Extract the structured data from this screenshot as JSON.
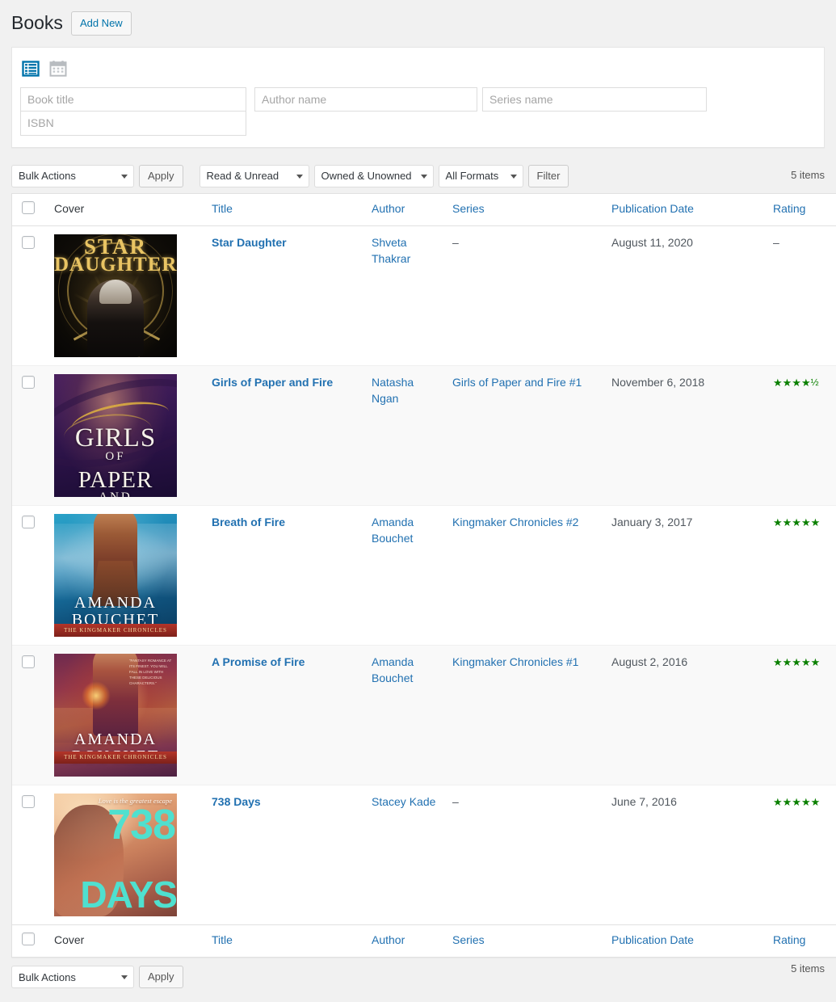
{
  "header": {
    "page_title": "Books",
    "add_new_label": "Add New"
  },
  "search_panel": {
    "view_icons": [
      {
        "name": "list-view-icon",
        "label": "List view",
        "active": true
      },
      {
        "name": "calendar-view-icon",
        "label": "Calendar view",
        "active": false
      }
    ],
    "fields": {
      "book_title": {
        "placeholder": "Book title",
        "value": ""
      },
      "isbn": {
        "placeholder": "ISBN",
        "value": ""
      },
      "author_name": {
        "placeholder": "Author name",
        "value": ""
      },
      "series_name": {
        "placeholder": "Series name",
        "value": ""
      }
    }
  },
  "tablenav_top": {
    "bulk_actions": "Bulk Actions",
    "apply_label": "Apply",
    "read_filter": "Read & Unread",
    "owned_filter": "Owned & Unowned",
    "format_filter": "All Formats",
    "filter_label": "Filter",
    "items_count": "5 items"
  },
  "tablenav_bottom": {
    "bulk_actions": "Bulk Actions",
    "apply_label": "Apply",
    "items_count": "5 items"
  },
  "table": {
    "columns": {
      "cover": "Cover",
      "title": "Title",
      "author": "Author",
      "series": "Series",
      "publication_date": "Publication Date",
      "rating": "Rating"
    },
    "rows": [
      {
        "title": "Star Daughter",
        "author": "Shveta Thakrar",
        "series": "–",
        "series_is_link": false,
        "publication_date": "August 11, 2020",
        "rating_stars": "–",
        "rating_value": null,
        "cover": {
          "style": "cv-star",
          "title_line1": "STAR",
          "title_line2": "DAUGHTER"
        }
      },
      {
        "title": "Girls of Paper and Fire",
        "author": "Natasha Ngan",
        "series": "Girls of Paper and Fire #1",
        "series_is_link": true,
        "publication_date": "November 6, 2018",
        "rating_stars": "★★★★",
        "rating_half": "½",
        "rating_value": 4.5,
        "cover": {
          "style": "cv-girls",
          "line1": "GIRLS",
          "line2": "OF",
          "line3": "PAPER",
          "line4": "AND"
        }
      },
      {
        "title": "Breath of Fire",
        "author": "Amanda Bouchet",
        "series": "Kingmaker Chronicles #2",
        "series_is_link": true,
        "publication_date": "January 3, 2017",
        "rating_stars": "★★★★★",
        "rating_value": 5,
        "cover": {
          "style": "cv-breath",
          "name1": "AMANDA",
          "name2": "BOUCHET",
          "banner": "THE KINGMAKER CHRONICLES"
        }
      },
      {
        "title": "A Promise of Fire",
        "author": "Amanda Bouchet",
        "series": "Kingmaker Chronicles #1",
        "series_is_link": true,
        "publication_date": "August 2, 2016",
        "rating_stars": "★★★★★",
        "rating_value": 5,
        "cover": {
          "style": "cv-promise",
          "name1": "AMANDA",
          "name2": "BOUCHET",
          "banner": "THE KINGMAKER CHRONICLES",
          "quote": "“FANTASY ROMANCE AT ITS FINEST. YOU WILL FALL IN LOVE WITH THESE DELICIOUS CHARACTERS.”"
        }
      },
      {
        "title": "738 Days",
        "author": "Stacey Kade",
        "series": "–",
        "series_is_link": false,
        "publication_date": "June 7, 2016",
        "rating_stars": "★★★★★",
        "rating_value": 5,
        "cover": {
          "style": "cv-738",
          "tagline": "Love is the greatest escape",
          "number": "738",
          "word": "DAYS"
        }
      }
    ]
  },
  "colors": {
    "link": "#2271b1",
    "star": "#0a8000",
    "page_bg": "#f1f1f1",
    "row_alt": "#f9f9f9"
  }
}
